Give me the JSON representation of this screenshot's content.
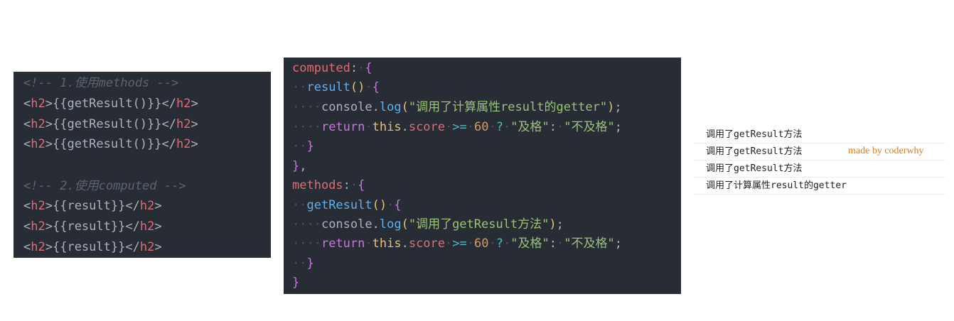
{
  "template_panel": {
    "comment1": "<!-- 1.使用methods -->",
    "lines_a": [
      "{{getResult()}}",
      "{{getResult()}}",
      "{{getResult()}}"
    ],
    "comment2": "<!-- 2.使用computed -->",
    "lines_b": [
      "{{result}}",
      "{{result}}",
      "{{result}}"
    ],
    "tag": "h2"
  },
  "script_panel": {
    "computed_key": "computed",
    "result_fn": "result",
    "console_obj": "console",
    "log_fn": "log",
    "computed_log_str": "\"调用了计算属性result的getter\"",
    "return_kw": "return",
    "this_kw": "this",
    "score_prop": "score",
    "compare_op": ">=",
    "threshold": "60",
    "pass_str": "\"及格\"",
    "fail_str": "\"不及格\"",
    "methods_key": "methods",
    "getresult_fn": "getResult",
    "method_log_str": "\"调用了getResult方法\""
  },
  "console_output": [
    "调用了getResult方法",
    "调用了getResult方法",
    "调用了getResult方法",
    "调用了计算属性result的getter"
  ],
  "watermark": "made by coderwhy"
}
